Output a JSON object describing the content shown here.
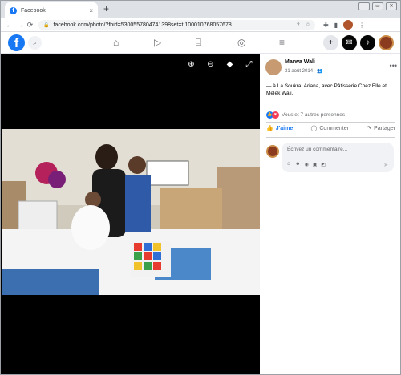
{
  "browser": {
    "tab_title": "Facebook",
    "tab_favicon": "f",
    "tab_close": "×",
    "new_tab": "+",
    "url": "facebook.com/photo/?fbid=5300557804741398set=t.100010768057678",
    "window_controls": {
      "minimize": "—",
      "restore": "▭",
      "close": "✕"
    }
  },
  "fb_header": {
    "logo": "f"
  },
  "post": {
    "author": "Marwa Wali",
    "date": "31 août 2014 · ",
    "caption": "— à La Soukra, Ariana, avec Pâtisserie Chez Elle et Melek Wali.",
    "reactions": "Vous et 7 autres personnes",
    "actions": {
      "like": "J'aime",
      "comment": "Commenter",
      "share": "Partager"
    },
    "comment_placeholder": "Écrivez un commentaire..."
  },
  "colors": {
    "brand": "#1877f2",
    "love": "#f33e58"
  }
}
